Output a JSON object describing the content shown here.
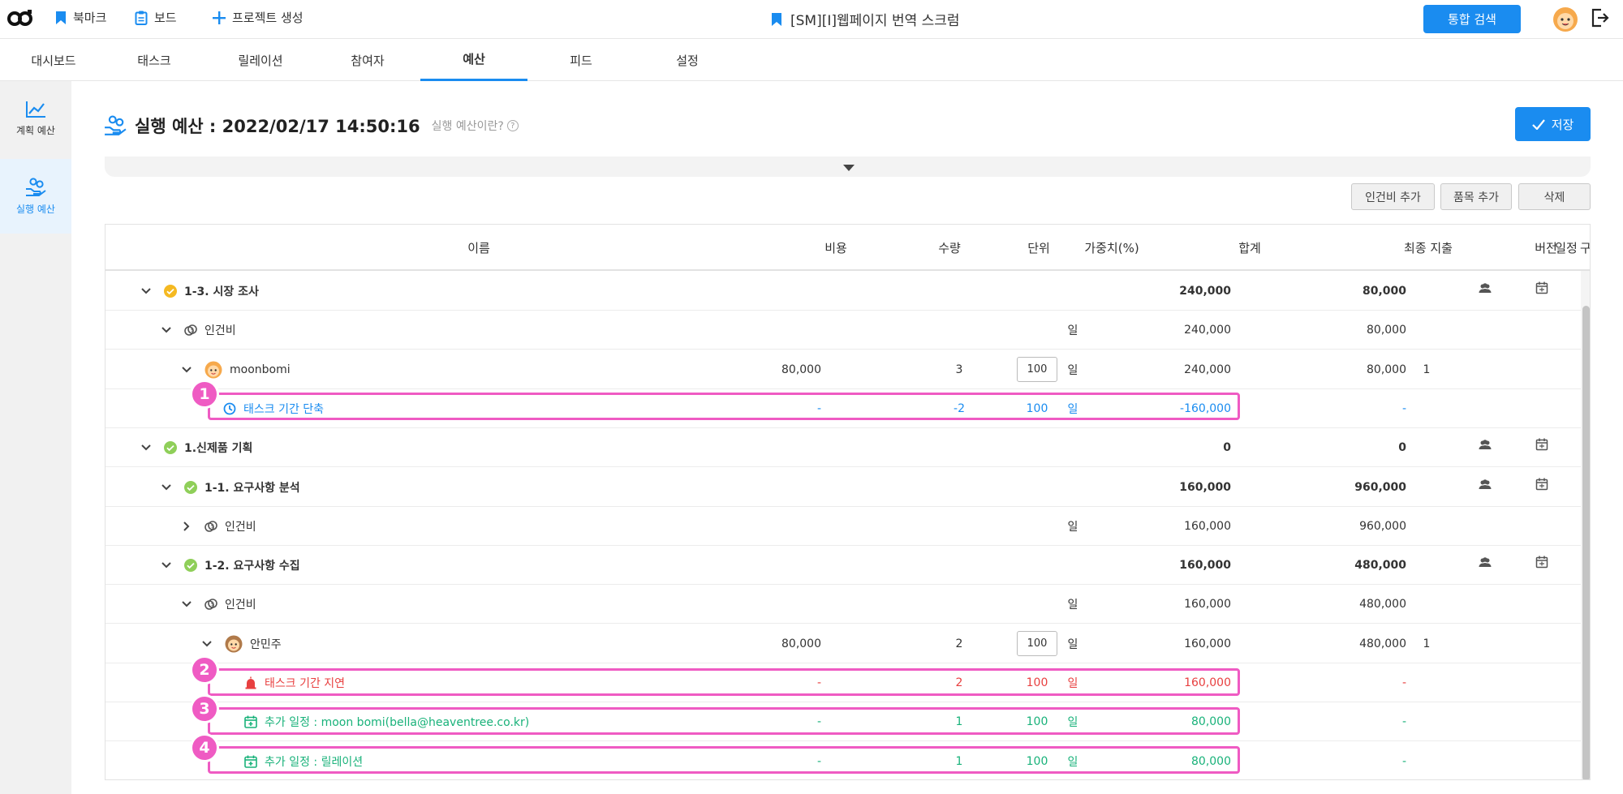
{
  "topbar": {
    "bookmark_label": "북마크",
    "board_label": "보드",
    "create_label": "프로젝트 생성",
    "project_title": "[SM][I]웹페이지 번역 스크럼",
    "search_label": "통합 검색"
  },
  "tabs": [
    {
      "label": "대시보드"
    },
    {
      "label": "태스크"
    },
    {
      "label": "릴레이션"
    },
    {
      "label": "참여자"
    },
    {
      "label": "예산",
      "active": true
    },
    {
      "label": "피드"
    },
    {
      "label": "설정"
    }
  ],
  "sidebar": {
    "items": [
      {
        "label": "계획 예산"
      },
      {
        "label": "실행 예산",
        "active": true
      }
    ]
  },
  "page": {
    "title": "실행 예산 : 2022/02/17 14:50:16",
    "help_text": "실행 예산이란?",
    "help_icon_text": "?",
    "save_label": "저장",
    "add_labor_label": "인건비 추가",
    "add_item_label": "품목 추가",
    "delete_label": "삭제"
  },
  "table": {
    "headers": {
      "name": "이름",
      "cost": "비용",
      "qty": "수량",
      "unit": "단위",
      "weight": "가중치(%)",
      "total": "합계",
      "final": "최종 지출",
      "version": "버전",
      "members": "구성 인원",
      "schedule": "일정"
    },
    "rows": [
      {
        "level": 0,
        "name": "1-3. 시장 조사",
        "status": "yellow",
        "total": "240,000",
        "final": "80,000",
        "bold": true,
        "icons": true
      },
      {
        "level": 1,
        "name": "인건비",
        "unit": "일",
        "total": "240,000",
        "final": "80,000"
      },
      {
        "level": 2,
        "name": "moonbomi",
        "cost": "80,000",
        "qty": "3",
        "unit": "일",
        "weight": "100",
        "total": "240,000",
        "final": "80,000",
        "version": "1"
      },
      {
        "level": 3,
        "name": "태스크 기간 단축",
        "tone": "blue",
        "cost": "-",
        "qty": "-2",
        "unit": "일",
        "weight": "100",
        "total": "-160,000",
        "final": "-"
      },
      {
        "level": 0,
        "name": "1.신제품 기획",
        "status": "green",
        "total": "0",
        "final": "0",
        "bold": true,
        "icons": true
      },
      {
        "level": 1,
        "name": "1-1. 요구사항 분석",
        "status": "green",
        "total": "160,000",
        "final": "960,000",
        "bold": true,
        "icons": true
      },
      {
        "level": 2,
        "name": "인건비",
        "unit": "일",
        "total": "160,000",
        "final": "960,000",
        "collapsed": true
      },
      {
        "level": 1,
        "name": "1-2. 요구사항 수집",
        "status": "green",
        "total": "160,000",
        "final": "480,000",
        "bold": true,
        "icons": true
      },
      {
        "level": 2,
        "name": "인건비",
        "unit": "일",
        "total": "160,000",
        "final": "480,000"
      },
      {
        "level": 3,
        "name": "안민주",
        "cost": "80,000",
        "qty": "2",
        "unit": "일",
        "weight": "100",
        "total": "160,000",
        "final": "480,000",
        "version": "1"
      },
      {
        "level": 4,
        "name": "태스크 기간 지연",
        "tone": "red",
        "cost": "-",
        "qty": "2",
        "unit": "일",
        "weight": "100",
        "total": "160,000",
        "final": "-"
      },
      {
        "level": 4,
        "name": "추가 일정 : moon bomi(bella@heaventree.co.kr)",
        "tone": "green",
        "cost": "-",
        "qty": "1",
        "unit": "일",
        "weight": "100",
        "total": "80,000",
        "final": "-"
      },
      {
        "level": 4,
        "name": "추가 일정 : 릴레이션",
        "tone": "green",
        "cost": "-",
        "qty": "1",
        "unit": "일",
        "weight": "100",
        "total": "80,000",
        "final": "-"
      }
    ]
  },
  "annotations": [
    "1",
    "2",
    "3",
    "4"
  ],
  "colors": {
    "accent": "#1a8cf0",
    "highlight": "#ef5bc3",
    "negative": "#e84040",
    "addition": "#19b27a",
    "status_yellow": "#f5b921",
    "status_green": "#8fcf59"
  }
}
